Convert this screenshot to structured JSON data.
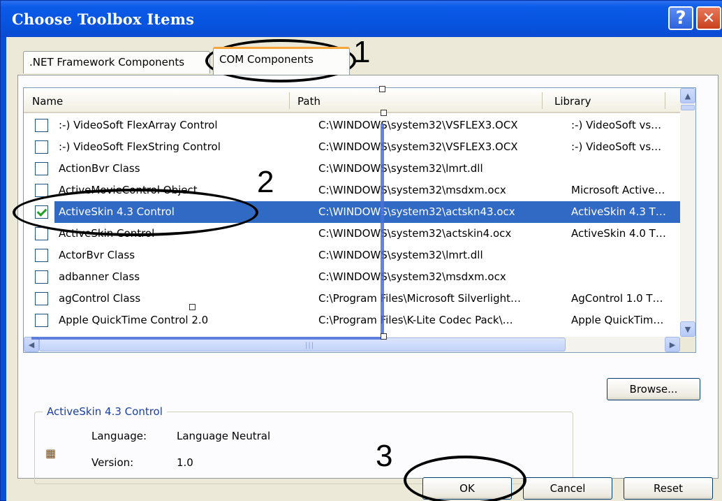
{
  "window": {
    "title": "Choose Toolbox Items"
  },
  "titlebar": {
    "help_label": "?",
    "close_label": "✕"
  },
  "tabs": [
    {
      "label": ".NET Framework Components",
      "active": false
    },
    {
      "label": "COM Components",
      "active": true
    }
  ],
  "list": {
    "columns": [
      "Name",
      "Path",
      "Library"
    ],
    "rows": [
      {
        "name": ":-) VideoSoft FlexArray Control",
        "path": "C:\\WINDOWS\\system32\\VSFLEX3.OCX",
        "library": ":-) VideoSoft vs…",
        "checked": false
      },
      {
        "name": ":-) VideoSoft FlexString Control",
        "path": "C:\\WINDOWS\\system32\\VSFLEX3.OCX",
        "library": ":-) VideoSoft vs…",
        "checked": false
      },
      {
        "name": "ActionBvr Class",
        "path": "C:\\WINDOWS\\system32\\lmrt.dll",
        "library": "",
        "checked": false
      },
      {
        "name": "ActiveMovieControl Object",
        "path": "C:\\WINDOWS\\system32\\msdxm.ocx",
        "library": "Microsoft Active…",
        "checked": false
      },
      {
        "name": "ActiveSkin 4.3 Control",
        "path": "C:\\WINDOWS\\system32\\actskn43.ocx",
        "library": "ActiveSkin 4.3 T…",
        "checked": true,
        "selected": true
      },
      {
        "name": "ActiveSkin Control",
        "path": "C:\\WINDOWS\\system32\\actskin4.ocx",
        "library": "ActiveSkin 4.0 T…",
        "checked": false
      },
      {
        "name": "ActorBvr Class",
        "path": "C:\\WINDOWS\\system32\\lmrt.dll",
        "library": "",
        "checked": false
      },
      {
        "name": "adbanner Class",
        "path": "C:\\WINDOWS\\system32\\msdxm.ocx",
        "library": "",
        "checked": false
      },
      {
        "name": "agControl Class",
        "path": "C:\\Program Files\\Microsoft Silverlight…",
        "library": "AgControl 1.0 T…",
        "checked": false
      },
      {
        "name": "Apple QuickTime Control 2.0",
        "path": "C:\\Program Files\\K-Lite Codec Pack\\…",
        "library": "Apple QuickTim…",
        "checked": false
      }
    ]
  },
  "details": {
    "group_title": "ActiveSkin 4.3 Control",
    "language_label": "Language:",
    "language_value": "Language Neutral",
    "version_label": "Version:",
    "version_value": "1.0"
  },
  "buttons": {
    "browse": "Browse...",
    "ok": "OK",
    "cancel": "Cancel",
    "reset": "Reset"
  },
  "annotations": [
    "1",
    "2",
    "3"
  ],
  "colors": {
    "titlebar": "#0754e0",
    "selection": "#316ac5",
    "dialog_bg": "#ece9d8",
    "tab_highlight": "#f7a53b"
  },
  "icons": {
    "help": "help-icon",
    "close": "close-icon",
    "scroll_up": "arrow-up-icon",
    "scroll_down": "arrow-down-icon",
    "scroll_left": "arrow-left-icon",
    "scroll_right": "arrow-right-icon",
    "component": "activex-component-icon"
  }
}
